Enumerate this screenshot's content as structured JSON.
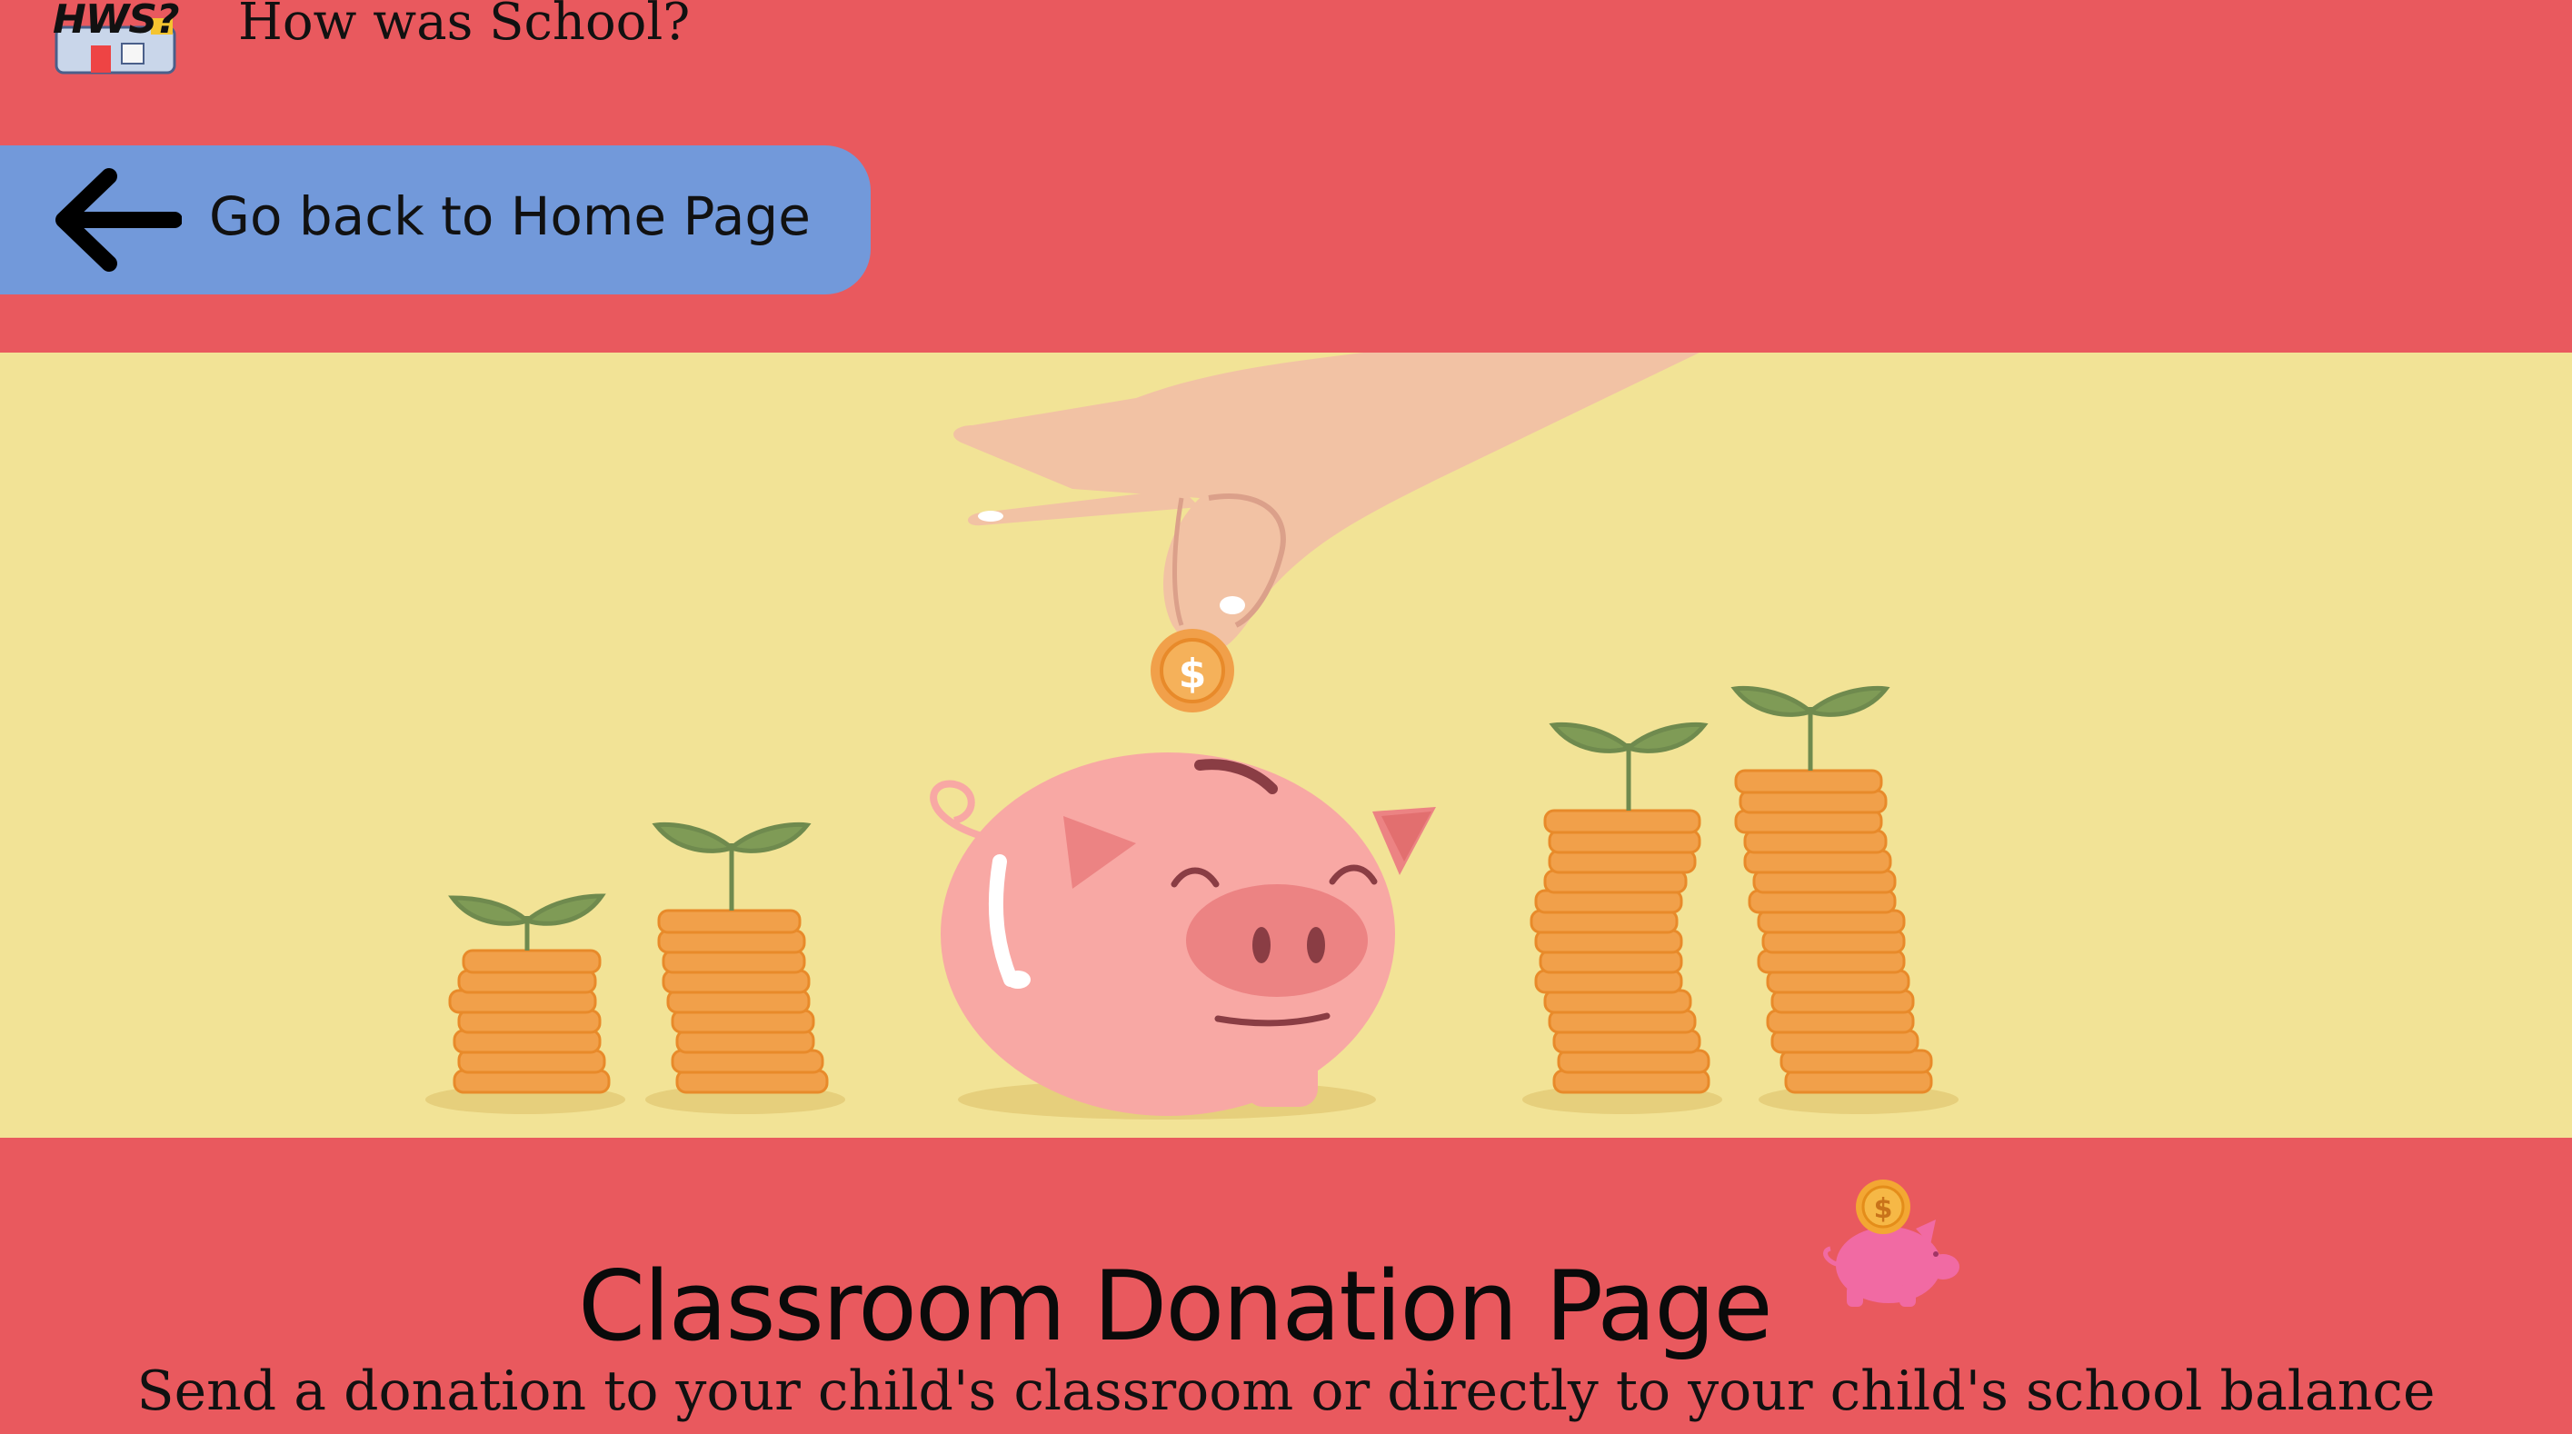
{
  "header": {
    "logo_text": "HWS?",
    "site_title": "How was School?"
  },
  "nav": {
    "back_label": "Go back to Home Page"
  },
  "banner": {
    "coin_symbol": "$"
  },
  "main": {
    "title": "Classroom Donation Page",
    "subtitle": "Send a donation to your child's classroom or directly to your child's school balance",
    "icon_coin_symbol": "$"
  },
  "colors": {
    "background": "#e9595e",
    "button": "#7299da",
    "banner": "#f2e396",
    "coin": "#f1a04a",
    "pig": "#f8a8a4"
  }
}
